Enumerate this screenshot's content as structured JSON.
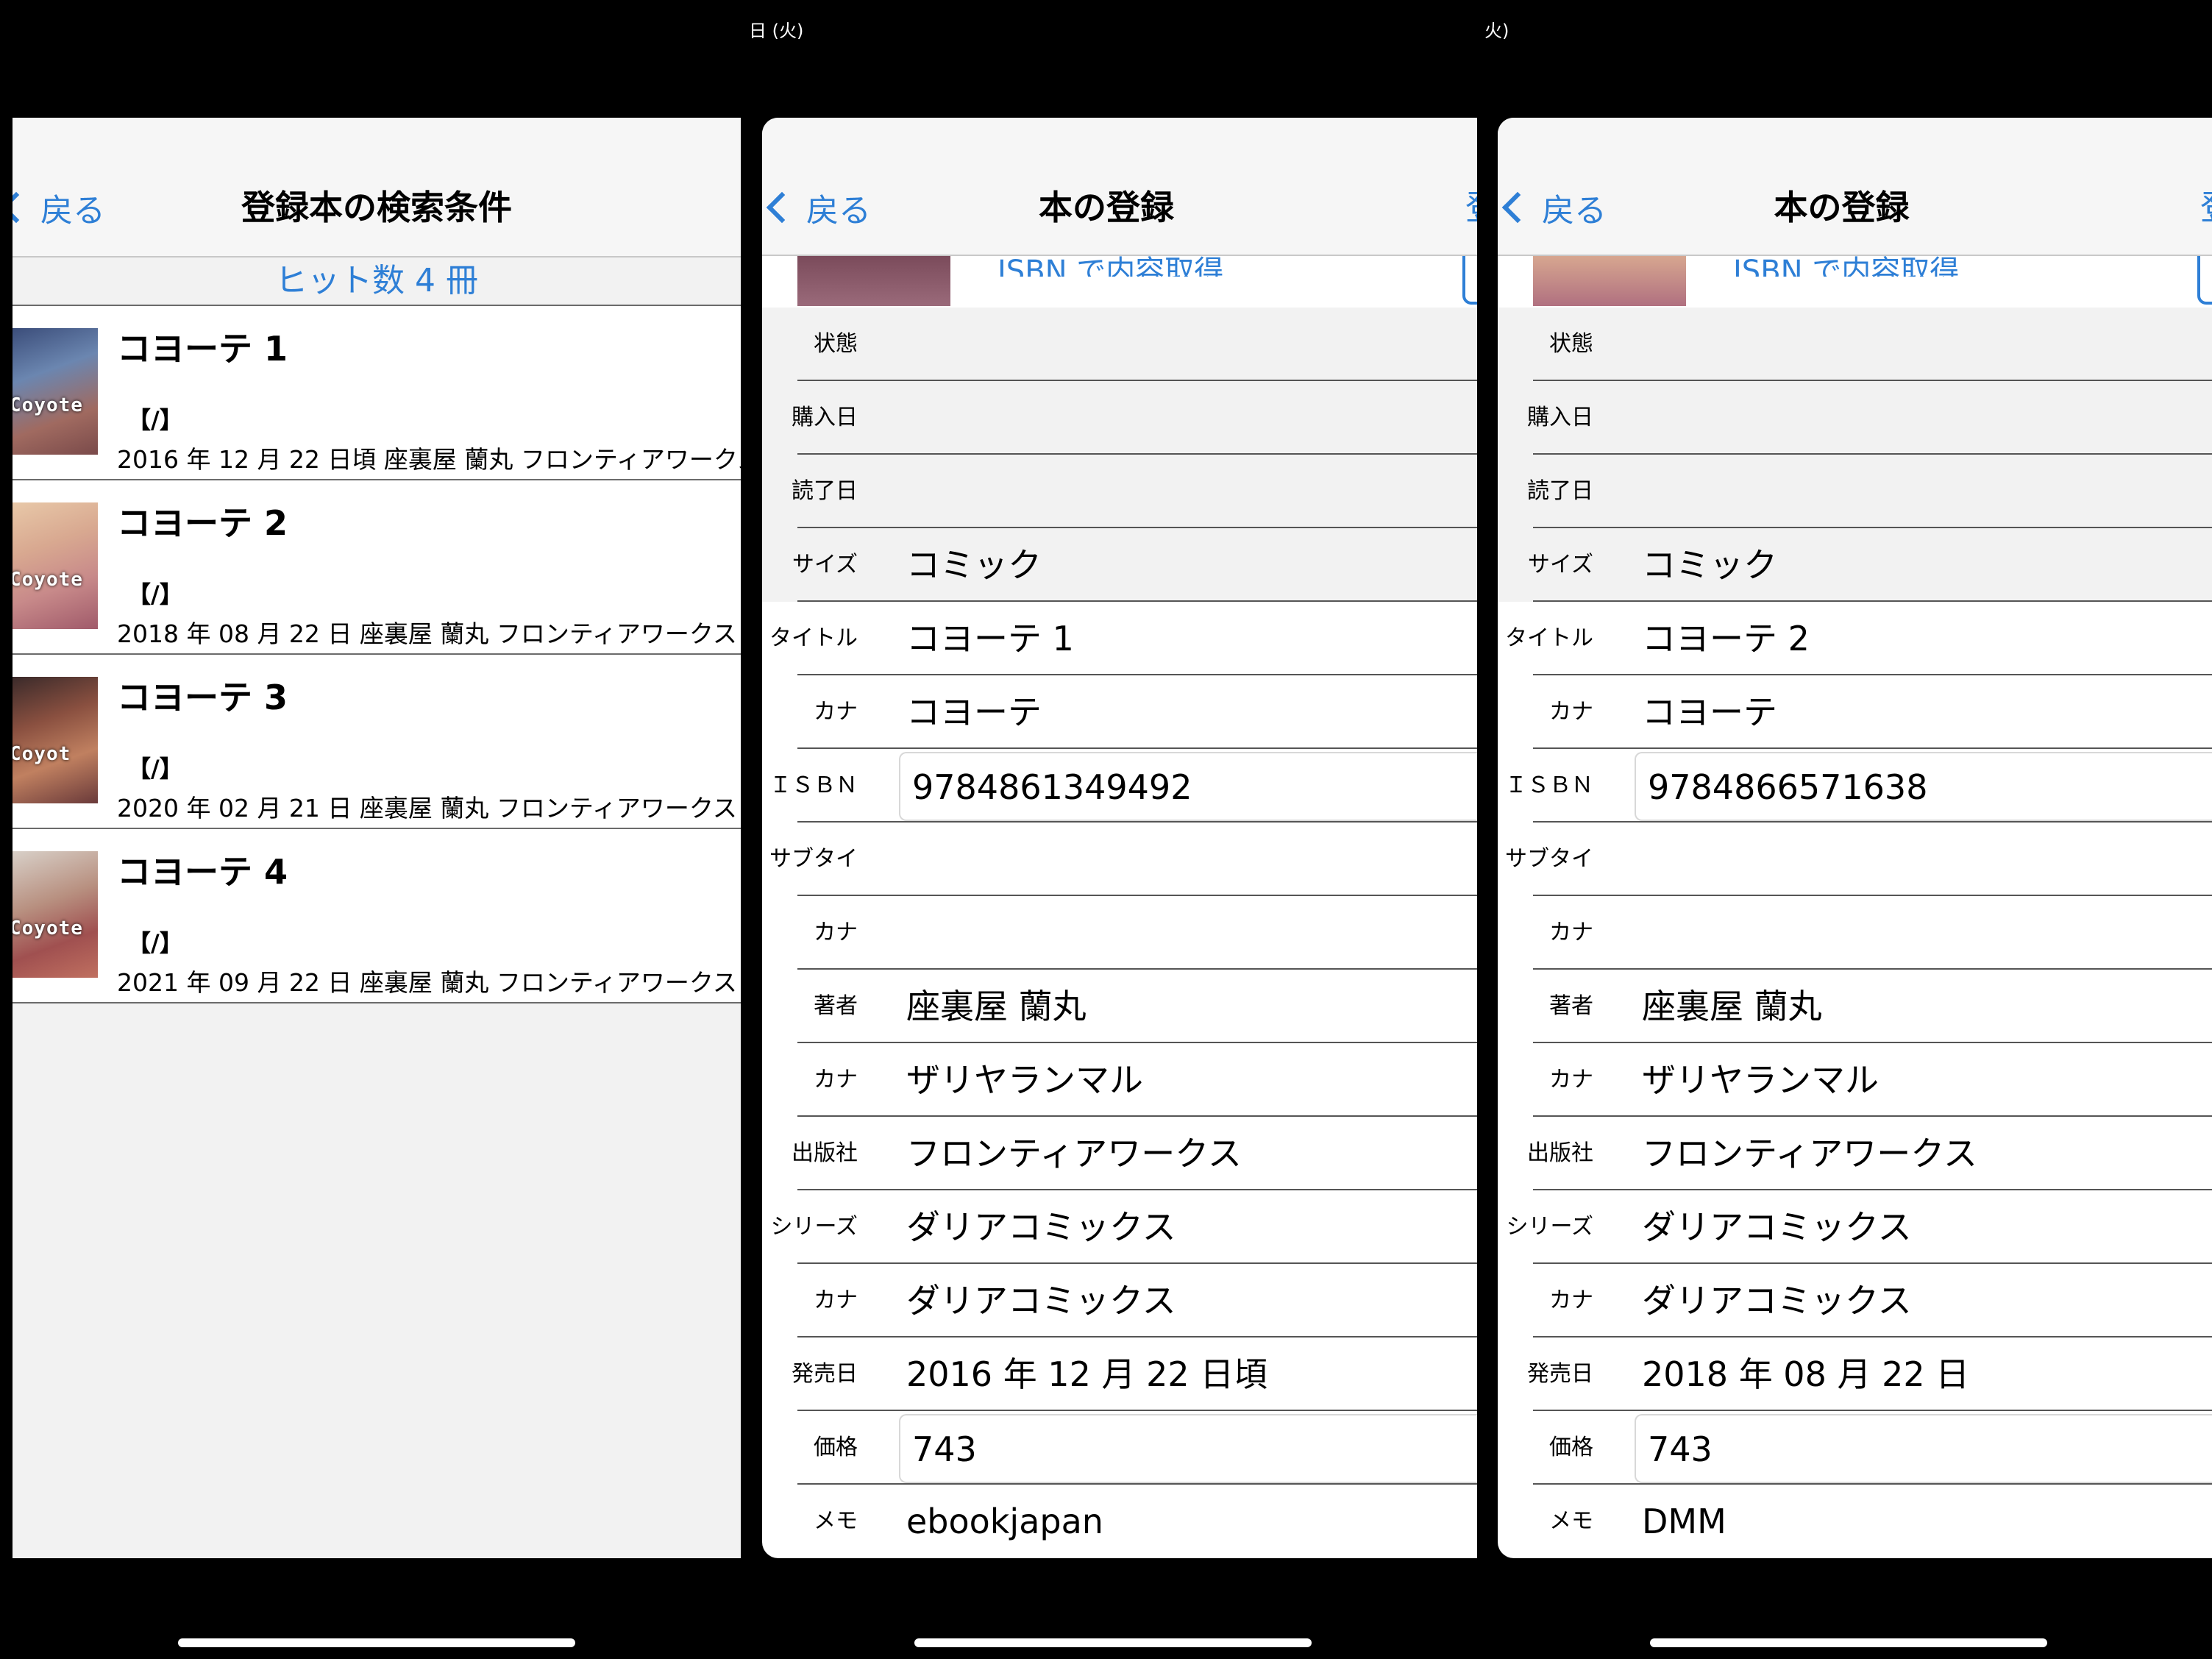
{
  "list_screen": {
    "back_label": "戻る",
    "title": "登録本の検索条件",
    "hit_count": "ヒット数 4 冊",
    "items": [
      {
        "title": "コヨーテ 1",
        "subtitle": "【/】",
        "info": "2016 年 12 月 22 日頃 座裏屋 蘭丸 フロンティアワークス",
        "cover_text": "Coyote"
      },
      {
        "title": "コヨーテ 2",
        "subtitle": "【/】",
        "info": "2018 年 08 月 22 日 座裏屋 蘭丸 フロンティアワークス",
        "cover_text": "Coyote"
      },
      {
        "title": "コヨーテ 3",
        "subtitle": "【/】",
        "info": "2020 年 02 月 21 日 座裏屋 蘭丸 フロンティアワークス",
        "cover_text": "Coyot"
      },
      {
        "title": "コヨーテ 4",
        "subtitle": "【/】",
        "info": "2021 年 09 月 22 日 座裏屋 蘭丸 フロンティアワークス",
        "cover_text": "Coyote"
      }
    ]
  },
  "detail_screen_1": {
    "status_text": "日 (火)",
    "back_label": "戻る",
    "title": "本の登録",
    "right_label": "登",
    "isbn_button": "ISBN で内容取得",
    "fields": {
      "status": {
        "label": "状態",
        "value": ""
      },
      "purchase_date": {
        "label": "購入日",
        "value": ""
      },
      "read_date": {
        "label": "読了日",
        "value": ""
      },
      "size": {
        "label": "サイズ",
        "value": "コミック"
      },
      "title": {
        "label": "タイトル",
        "value": "コヨーテ 1"
      },
      "title_kana": {
        "label": "カナ",
        "value": "コヨーテ"
      },
      "isbn": {
        "label": "ＩＳＢＮ",
        "value": "9784861349492"
      },
      "subtitle": {
        "label": "サブタイ",
        "value": ""
      },
      "subtitle_kana": {
        "label": "カナ",
        "value": ""
      },
      "author": {
        "label": "著者",
        "value": "座裏屋 蘭丸"
      },
      "author_kana": {
        "label": "カナ",
        "value": "ザリヤランマル"
      },
      "publisher": {
        "label": "出版社",
        "value": "フロンティアワークス"
      },
      "series": {
        "label": "シリーズ",
        "value": "ダリアコミックス"
      },
      "series_kana": {
        "label": "カナ",
        "value": "ダリアコミックス"
      },
      "release_date": {
        "label": "発売日",
        "value": "2016 年 12 月 22 日頃"
      },
      "price": {
        "label": "価格",
        "value": "743"
      },
      "memo": {
        "label": "メモ",
        "value": "ebookjapan"
      }
    }
  },
  "detail_screen_2": {
    "status_text": "火)",
    "back_label": "戻る",
    "title": "本の登録",
    "right_label": "登",
    "isbn_button": "ISBN で内容取得",
    "fields": {
      "status": {
        "label": "状態",
        "value": ""
      },
      "purchase_date": {
        "label": "購入日",
        "value": ""
      },
      "read_date": {
        "label": "読了日",
        "value": ""
      },
      "size": {
        "label": "サイズ",
        "value": "コミック"
      },
      "title": {
        "label": "タイトル",
        "value": "コヨーテ 2"
      },
      "title_kana": {
        "label": "カナ",
        "value": "コヨーテ"
      },
      "isbn": {
        "label": "ＩＳＢＮ",
        "value": "9784866571638"
      },
      "subtitle": {
        "label": "サブタイ",
        "value": ""
      },
      "subtitle_kana": {
        "label": "カナ",
        "value": ""
      },
      "author": {
        "label": "著者",
        "value": "座裏屋 蘭丸"
      },
      "author_kana": {
        "label": "カナ",
        "value": "ザリヤランマル"
      },
      "publisher": {
        "label": "出版社",
        "value": "フロンティアワークス"
      },
      "series": {
        "label": "シリーズ",
        "value": "ダリアコミックス"
      },
      "series_kana": {
        "label": "カナ",
        "value": "ダリアコミックス"
      },
      "release_date": {
        "label": "発売日",
        "value": "2018 年 08 月 22 日"
      },
      "price": {
        "label": "価格",
        "value": "743"
      },
      "memo": {
        "label": "メモ",
        "value": "DMM"
      }
    }
  }
}
